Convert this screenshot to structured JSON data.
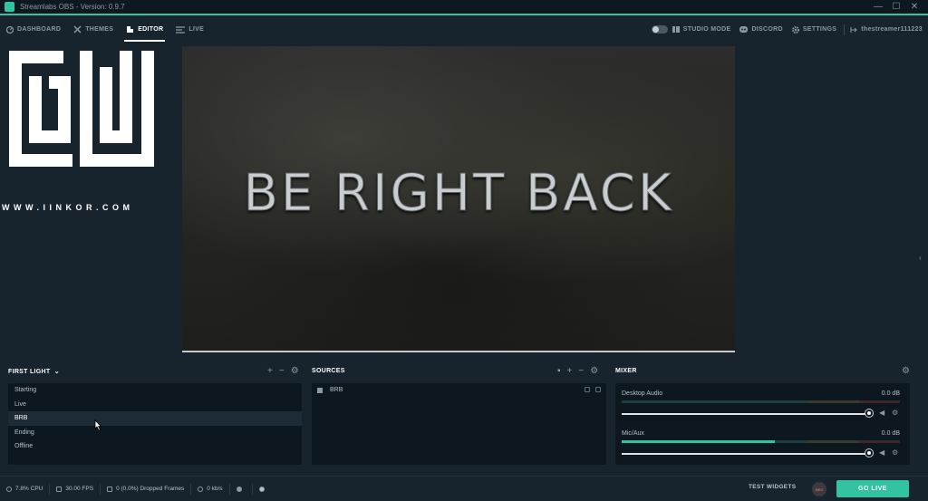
{
  "window": {
    "title": "Streamlabs OBS - Version: 0.9.7",
    "controls": [
      "—",
      "☐",
      "✕"
    ]
  },
  "nav": {
    "items": [
      {
        "label": "DASHBOARD",
        "icon": "dashboard-icon"
      },
      {
        "label": "THEMES",
        "icon": "themes-icon"
      },
      {
        "label": "EDITOR",
        "icon": "editor-icon",
        "active": true
      },
      {
        "label": "LIVE",
        "icon": "live-icon"
      }
    ],
    "studio_mode": "STUDIO MODE",
    "discord": "DISCORD",
    "settings": "SETTINGS",
    "user": "thestreamer111223"
  },
  "watermark": {
    "logo_text": "IINKOR",
    "caption": "WWW.IINKOR.COM"
  },
  "preview": {
    "overlay_text": "BE RIGHT BACK"
  },
  "scenes": {
    "collection": "FIRST LIGHT",
    "items": [
      "Starting",
      "Live",
      "BRB",
      "Ending",
      "Offline"
    ],
    "selected_index": 2
  },
  "sources": {
    "title": "SOURCES",
    "items": [
      "BRB"
    ]
  },
  "mixer": {
    "title": "MIXER",
    "channels": [
      {
        "name": "Desktop Audio",
        "db": "0.0 dB",
        "level": 0.0,
        "volume": 1.0
      },
      {
        "name": "Mic/Aux",
        "db": "0.0 dB",
        "level": 0.55,
        "volume": 1.0
      }
    ]
  },
  "footer": {
    "cpu": "7.8% CPU",
    "fps": "30.00 FPS",
    "dropped": "0 (0.0%) Dropped Frames",
    "bitrate": "0 kb/s",
    "test_widgets": "TEST WIDGETS",
    "rec": "REC",
    "go_live": "GO LIVE"
  },
  "colors": {
    "accent": "#31c3a2",
    "background": "#17242d",
    "panel": "#0c1720"
  }
}
